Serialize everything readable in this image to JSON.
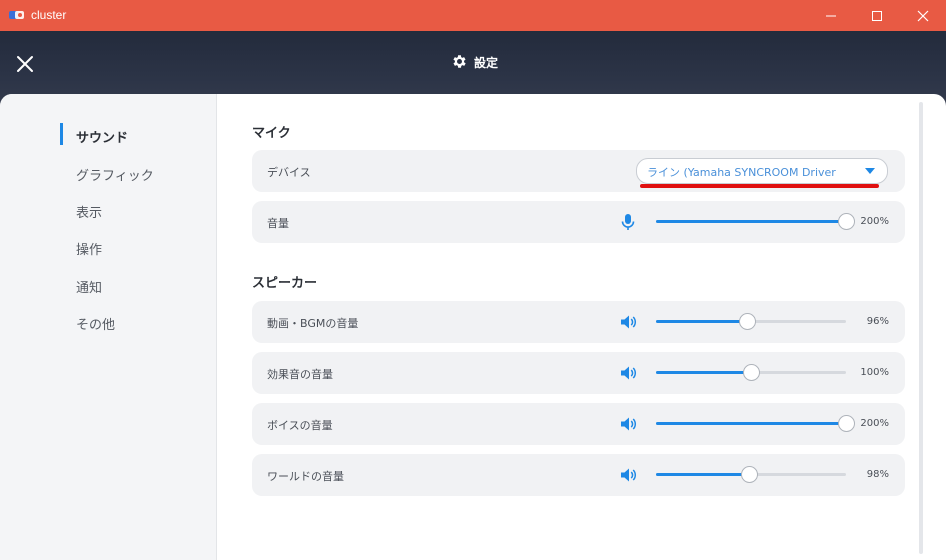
{
  "window": {
    "title": "cluster"
  },
  "header": {
    "title": "設定"
  },
  "sidebar": {
    "items": [
      {
        "label": "サウンド",
        "active": true
      },
      {
        "label": "グラフィック"
      },
      {
        "label": "表示"
      },
      {
        "label": "操作"
      },
      {
        "label": "通知"
      },
      {
        "label": "その他"
      }
    ]
  },
  "mic": {
    "section_title": "マイク",
    "device_label": "デバイス",
    "device_value": "ライン (Yamaha SYNCROOM Driver",
    "volume_label": "音量",
    "volume_value": "200%",
    "volume_fraction": 1.0
  },
  "speaker": {
    "section_title": "スピーカー",
    "rows": [
      {
        "label": "動画・BGMの音量",
        "value": "96%",
        "fraction": 0.48
      },
      {
        "label": "効果音の音量",
        "value": "100%",
        "fraction": 0.5
      },
      {
        "label": "ボイスの音量",
        "value": "200%",
        "fraction": 1.0
      },
      {
        "label": "ワールドの音量",
        "value": "98%",
        "fraction": 0.49
      }
    ]
  },
  "colors": {
    "titlebar": "#e85a44",
    "accent": "#1e88e5",
    "highlight_underline": "#e01010"
  }
}
